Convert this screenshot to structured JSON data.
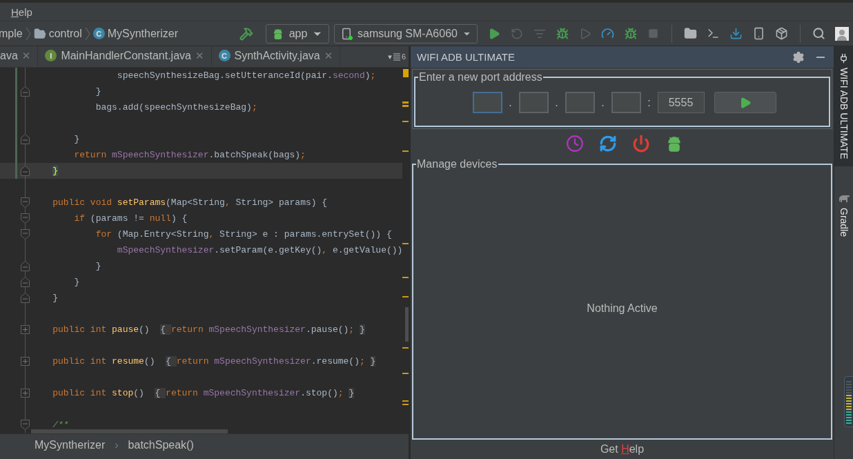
{
  "menu": [
    {
      "mnemonic": "H",
      "rest": "elp"
    }
  ],
  "breadcrumbs": [
    {
      "label": "mple",
      "kind": "text"
    },
    {
      "label": "control",
      "kind": "folder"
    },
    {
      "label": "MySyntherizer",
      "kind": "class",
      "badge": "C"
    }
  ],
  "run_config": {
    "label": "app"
  },
  "device": {
    "label": "samsung SM-A6060",
    "connected": true
  },
  "toolbar": [
    {
      "kind": "build",
      "disabled": false
    },
    {
      "kind": "run",
      "disabled": false
    },
    {
      "kind": "rerun",
      "disabled": true
    },
    {
      "kind": "apply",
      "disabled": true
    },
    {
      "kind": "debug",
      "disabled": false
    },
    {
      "kind": "coverage",
      "disabled": true
    },
    {
      "kind": "profile",
      "disabled": false
    },
    {
      "kind": "attach",
      "disabled": false
    },
    {
      "kind": "stop",
      "disabled": true
    },
    {
      "kind": "separator"
    },
    {
      "kind": "structure",
      "disabled": false
    },
    {
      "kind": "terminal",
      "disabled": false
    },
    {
      "kind": "sync",
      "disabled": false
    },
    {
      "kind": "avd",
      "disabled": false
    },
    {
      "kind": "sdk",
      "disabled": false
    },
    {
      "kind": "separator"
    },
    {
      "kind": "search",
      "disabled": false
    },
    {
      "kind": "avatar",
      "disabled": false
    }
  ],
  "tabs": [
    {
      "label": "ava",
      "close": "✕",
      "selected": false
    },
    {
      "label": "MainHandlerConstant.java",
      "badge": "I",
      "kind": "interface",
      "close": "✕",
      "selected": false
    },
    {
      "label": "SynthActivity.java",
      "badge": "C",
      "kind": "class",
      "close": "✕",
      "selected": false
    }
  ],
  "tab_overflow": {
    "arrow": "▾",
    "count": "6"
  },
  "code": [
    {
      "kind": "plain",
      "modified": true,
      "current": false,
      "tokens": [
        {
          "t": "                speechSynthesizeBag.setUtteranceId(pair.",
          "kind": "plain"
        },
        {
          "t": "second",
          "kind": "field"
        },
        {
          "t": ")",
          "kind": "plain"
        },
        {
          "t": ";",
          "kind": "keyword"
        }
      ]
    },
    {
      "kind": "fold-end",
      "modified": true,
      "current": false,
      "tokens": [
        {
          "t": "            }",
          "kind": "plain"
        }
      ]
    },
    {
      "kind": "plain",
      "modified": true,
      "current": false,
      "tokens": [
        {
          "t": "            bags.add(speechSynthesizeBag)",
          "kind": "plain"
        },
        {
          "t": ";",
          "kind": "keyword"
        }
      ]
    },
    {
      "kind": "plain",
      "modified": true,
      "current": false
    },
    {
      "kind": "fold-end",
      "modified": true,
      "current": false,
      "tokens": [
        {
          "t": "        }",
          "kind": "plain"
        }
      ]
    },
    {
      "kind": "plain",
      "modified": true,
      "current": false,
      "tokens": [
        {
          "t": "        return ",
          "kind": "keyword"
        },
        {
          "t": "mSpeechSynthesizer",
          "kind": "field"
        },
        {
          "t": ".batchSpeak(bags)",
          "kind": "plain"
        },
        {
          "t": ";",
          "kind": "keyword"
        }
      ]
    },
    {
      "kind": "fold-end",
      "modified": true,
      "current": true,
      "tokens": [
        {
          "t": "    }",
          "kind": "brace-match"
        }
      ]
    },
    {
      "kind": "plain",
      "modified": false,
      "current": false
    },
    {
      "kind": "fold-start",
      "modified": false,
      "current": false,
      "tokens": [
        {
          "t": "    public void ",
          "kind": "keyword"
        },
        {
          "t": "setParams",
          "kind": "method"
        },
        {
          "t": "(Map<String",
          "kind": "plain"
        },
        {
          "t": ",",
          "kind": "keyword"
        },
        {
          "t": " String> params) {",
          "kind": "plain"
        }
      ]
    },
    {
      "kind": "fold-start",
      "modified": false,
      "current": false,
      "tokens": [
        {
          "t": "        if ",
          "kind": "keyword"
        },
        {
          "t": "(params != ",
          "kind": "plain"
        },
        {
          "t": "null",
          "kind": "keyword"
        },
        {
          "t": ") {",
          "kind": "plain"
        }
      ]
    },
    {
      "kind": "fold-start",
      "modified": false,
      "current": false,
      "tokens": [
        {
          "t": "            for ",
          "kind": "keyword"
        },
        {
          "t": "(Map.Entry<String",
          "kind": "plain"
        },
        {
          "t": ",",
          "kind": "keyword"
        },
        {
          "t": " String> e : params.entrySet()) {",
          "kind": "plain"
        }
      ]
    },
    {
      "kind": "plain",
      "modified": false,
      "current": false,
      "tokens": [
        {
          "t": "                mSpeechSynthesizer",
          "kind": "field"
        },
        {
          "t": ".setParam(e.getKey()",
          "kind": "plain"
        },
        {
          "t": ",",
          "kind": "keyword"
        },
        {
          "t": " e.getValue())",
          "kind": "plain"
        }
      ]
    },
    {
      "kind": "fold-end",
      "modified": false,
      "current": false,
      "tokens": [
        {
          "t": "            }",
          "kind": "plain"
        }
      ]
    },
    {
      "kind": "fold-end",
      "modified": false,
      "current": false,
      "tokens": [
        {
          "t": "        }",
          "kind": "plain"
        }
      ]
    },
    {
      "kind": "fold-end",
      "modified": false,
      "current": false,
      "tokens": [
        {
          "t": "    }",
          "kind": "plain"
        }
      ]
    },
    {
      "kind": "plain",
      "modified": false,
      "current": false
    },
    {
      "kind": "collapsed",
      "modified": false,
      "current": false,
      "tokens": [
        {
          "t": "    public int ",
          "kind": "keyword"
        },
        {
          "t": "pause",
          "kind": "method"
        },
        {
          "t": "() ",
          "kind": "plain"
        },
        {
          "t": " { ",
          "kind": "folded"
        },
        {
          "t": "return ",
          "kind": "keyword"
        },
        {
          "t": "mSpeechSynthesizer",
          "kind": "field"
        },
        {
          "t": ".pause()",
          "kind": "plain"
        },
        {
          "t": ";",
          "kind": "keyword"
        },
        {
          "t": " }",
          "kind": "folded"
        }
      ]
    },
    {
      "kind": "plain",
      "modified": false,
      "current": false
    },
    {
      "kind": "collapsed",
      "modified": false,
      "current": false,
      "tokens": [
        {
          "t": "    public int ",
          "kind": "keyword"
        },
        {
          "t": "resume",
          "kind": "method"
        },
        {
          "t": "() ",
          "kind": "plain"
        },
        {
          "t": " { ",
          "kind": "folded"
        },
        {
          "t": "return ",
          "kind": "keyword"
        },
        {
          "t": "mSpeechSynthesizer",
          "kind": "field"
        },
        {
          "t": ".resume()",
          "kind": "plain"
        },
        {
          "t": ";",
          "kind": "keyword"
        },
        {
          "t": " }",
          "kind": "folded"
        }
      ]
    },
    {
      "kind": "plain",
      "modified": false,
      "current": false
    },
    {
      "kind": "collapsed",
      "modified": false,
      "current": false,
      "tokens": [
        {
          "t": "    public int ",
          "kind": "keyword"
        },
        {
          "t": "stop",
          "kind": "method"
        },
        {
          "t": "() ",
          "kind": "plain"
        },
        {
          "t": " { ",
          "kind": "folded"
        },
        {
          "t": "return ",
          "kind": "keyword"
        },
        {
          "t": "mSpeechSynthesizer",
          "kind": "field"
        },
        {
          "t": ".stop()",
          "kind": "plain"
        },
        {
          "t": ";",
          "kind": "keyword"
        },
        {
          "t": " }",
          "kind": "folded"
        }
      ]
    },
    {
      "kind": "plain",
      "modified": false,
      "current": false
    },
    {
      "kind": "fold-start",
      "modified": false,
      "current": false,
      "tokens": [
        {
          "t": "    /**",
          "kind": "comment"
        }
      ]
    }
  ],
  "editor_breadcrumbs": {
    "items": [
      "MySyntherizer",
      "batchSpeak()"
    ],
    "separator": "›"
  },
  "panel": {
    "title": "WIFI ADB ULTIMATE",
    "port_group": {
      "legend": "Enter a new port address",
      "ip_fields": [
        {
          "focused": true
        },
        {
          "focused": false
        },
        {
          "focused": false
        },
        {
          "focused": false
        }
      ],
      "separators": [
        ".",
        ".",
        ".",
        ":"
      ],
      "port": {
        "value": "5555"
      }
    },
    "actions": [
      {
        "kind": "clock"
      },
      {
        "kind": "refresh"
      },
      {
        "kind": "power"
      },
      {
        "kind": "android"
      }
    ],
    "devices_group": {
      "legend": "Manage devices",
      "empty_text": "Nothing Active"
    },
    "help": {
      "before": "Get ",
      "mnemonic": "H",
      "after": "elp"
    }
  },
  "side_tabs": [
    {
      "label": "WIFI ADB ULTIMATE",
      "kind": "plugin",
      "selected": true
    },
    {
      "label": "Gradle",
      "kind": "gradle",
      "selected": false
    }
  ]
}
